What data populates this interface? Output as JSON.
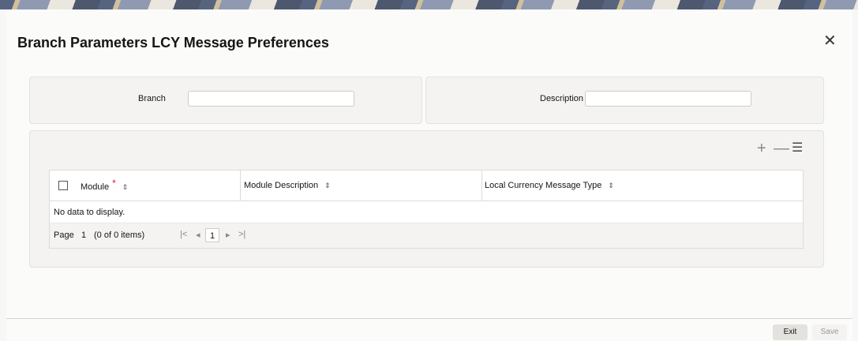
{
  "window": {
    "title": "Branch Parameters LCY Message Preferences",
    "close_icon": "close-icon"
  },
  "form": {
    "branch_label": "Branch",
    "branch_value": "",
    "description_label": "Description",
    "description_value": ""
  },
  "grid": {
    "toolbar": {
      "add_icon": "plus-icon",
      "remove_icon": "minus-icon",
      "columns_icon": "list-icon",
      "add_glyph": "+",
      "remove_glyph": "—",
      "columns_glyph": "☰"
    },
    "columns": [
      {
        "label": "Module",
        "required": true
      },
      {
        "label": "Module Description"
      },
      {
        "label": "Local Currency Message Type"
      }
    ],
    "required_marker": "*",
    "sort_glyph": "⇕",
    "empty_text": "No data to display.",
    "pager": {
      "page_label": "Page",
      "page_input": "1",
      "items_text": "(0 of 0 items)",
      "current_page": "1",
      "first_glyph": "|<",
      "prev_glyph": "◂",
      "next_glyph": "▸",
      "last_glyph": ">|"
    }
  },
  "footer": {
    "exit_label": "Exit",
    "save_label": "Save"
  }
}
